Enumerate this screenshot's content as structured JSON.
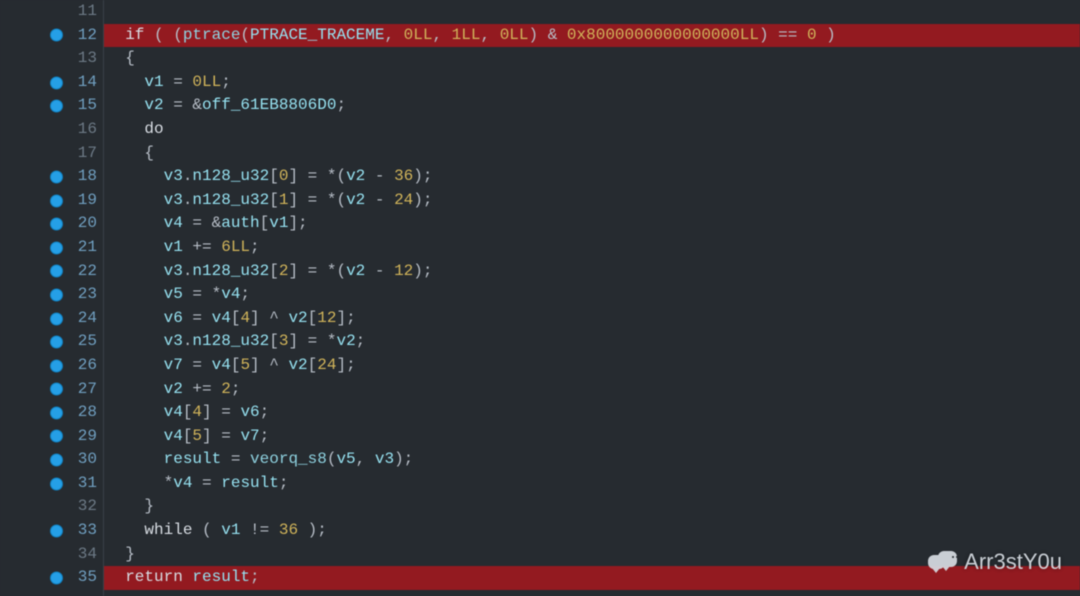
{
  "watermark_text": "Arr3stY0u",
  "lines": [
    {
      "n": 11,
      "bp": false,
      "hl": false,
      "tokens": []
    },
    {
      "n": 12,
      "bp": true,
      "hl": true,
      "tokens": [
        {
          "t": "  ",
          "c": "op"
        },
        {
          "t": "if",
          "c": "kw"
        },
        {
          "t": " ( (",
          "c": "op"
        },
        {
          "t": "ptrace",
          "c": "fn"
        },
        {
          "t": "(",
          "c": "op"
        },
        {
          "t": "PTRACE_TRACEME",
          "c": "id"
        },
        {
          "t": ", ",
          "c": "op"
        },
        {
          "t": "0LL",
          "c": "num"
        },
        {
          "t": ", ",
          "c": "op"
        },
        {
          "t": "1LL",
          "c": "num"
        },
        {
          "t": ", ",
          "c": "op"
        },
        {
          "t": "0LL",
          "c": "num"
        },
        {
          "t": ") & ",
          "c": "op"
        },
        {
          "t": "0x8000000000000000LL",
          "c": "hexnum"
        },
        {
          "t": ") == ",
          "c": "op"
        },
        {
          "t": "0",
          "c": "num"
        },
        {
          "t": " )",
          "c": "op"
        }
      ]
    },
    {
      "n": 13,
      "bp": false,
      "hl": false,
      "tokens": [
        {
          "t": "  {",
          "c": "op"
        }
      ]
    },
    {
      "n": 14,
      "bp": true,
      "hl": false,
      "tokens": [
        {
          "t": "    ",
          "c": "op"
        },
        {
          "t": "v1",
          "c": "id"
        },
        {
          "t": " = ",
          "c": "op"
        },
        {
          "t": "0LL",
          "c": "num"
        },
        {
          "t": ";",
          "c": "op"
        }
      ]
    },
    {
      "n": 15,
      "bp": true,
      "hl": false,
      "tokens": [
        {
          "t": "    ",
          "c": "op"
        },
        {
          "t": "v2",
          "c": "id"
        },
        {
          "t": " = &",
          "c": "op"
        },
        {
          "t": "off_61EB8806D0",
          "c": "id"
        },
        {
          "t": ";",
          "c": "op"
        }
      ]
    },
    {
      "n": 16,
      "bp": false,
      "hl": false,
      "tokens": [
        {
          "t": "    ",
          "c": "op"
        },
        {
          "t": "do",
          "c": "kw"
        }
      ]
    },
    {
      "n": 17,
      "bp": false,
      "hl": false,
      "tokens": [
        {
          "t": "    {",
          "c": "op"
        }
      ]
    },
    {
      "n": 18,
      "bp": true,
      "hl": false,
      "tokens": [
        {
          "t": "      ",
          "c": "op"
        },
        {
          "t": "v3",
          "c": "id"
        },
        {
          "t": ".",
          "c": "op"
        },
        {
          "t": "n128_u32",
          "c": "id"
        },
        {
          "t": "[",
          "c": "op"
        },
        {
          "t": "0",
          "c": "num"
        },
        {
          "t": "] = *(",
          "c": "op"
        },
        {
          "t": "v2",
          "c": "id"
        },
        {
          "t": " - ",
          "c": "op"
        },
        {
          "t": "36",
          "c": "num"
        },
        {
          "t": ");",
          "c": "op"
        }
      ]
    },
    {
      "n": 19,
      "bp": true,
      "hl": false,
      "tokens": [
        {
          "t": "      ",
          "c": "op"
        },
        {
          "t": "v3",
          "c": "id"
        },
        {
          "t": ".",
          "c": "op"
        },
        {
          "t": "n128_u32",
          "c": "id"
        },
        {
          "t": "[",
          "c": "op"
        },
        {
          "t": "1",
          "c": "num"
        },
        {
          "t": "] = *(",
          "c": "op"
        },
        {
          "t": "v2",
          "c": "id"
        },
        {
          "t": " - ",
          "c": "op"
        },
        {
          "t": "24",
          "c": "num"
        },
        {
          "t": ");",
          "c": "op"
        }
      ]
    },
    {
      "n": 20,
      "bp": true,
      "hl": false,
      "tokens": [
        {
          "t": "      ",
          "c": "op"
        },
        {
          "t": "v4",
          "c": "id"
        },
        {
          "t": " = &",
          "c": "op"
        },
        {
          "t": "auth",
          "c": "id"
        },
        {
          "t": "[",
          "c": "op"
        },
        {
          "t": "v1",
          "c": "id"
        },
        {
          "t": "];",
          "c": "op"
        }
      ]
    },
    {
      "n": 21,
      "bp": true,
      "hl": false,
      "tokens": [
        {
          "t": "      ",
          "c": "op"
        },
        {
          "t": "v1",
          "c": "id"
        },
        {
          "t": " += ",
          "c": "op"
        },
        {
          "t": "6LL",
          "c": "num"
        },
        {
          "t": ";",
          "c": "op"
        }
      ]
    },
    {
      "n": 22,
      "bp": true,
      "hl": false,
      "tokens": [
        {
          "t": "      ",
          "c": "op"
        },
        {
          "t": "v3",
          "c": "id"
        },
        {
          "t": ".",
          "c": "op"
        },
        {
          "t": "n128_u32",
          "c": "id"
        },
        {
          "t": "[",
          "c": "op"
        },
        {
          "t": "2",
          "c": "num"
        },
        {
          "t": "] = *(",
          "c": "op"
        },
        {
          "t": "v2",
          "c": "id"
        },
        {
          "t": " - ",
          "c": "op"
        },
        {
          "t": "12",
          "c": "num"
        },
        {
          "t": ");",
          "c": "op"
        }
      ]
    },
    {
      "n": 23,
      "bp": true,
      "hl": false,
      "tokens": [
        {
          "t": "      ",
          "c": "op"
        },
        {
          "t": "v5",
          "c": "id"
        },
        {
          "t": " = *",
          "c": "op"
        },
        {
          "t": "v4",
          "c": "id"
        },
        {
          "t": ";",
          "c": "op"
        }
      ]
    },
    {
      "n": 24,
      "bp": true,
      "hl": false,
      "tokens": [
        {
          "t": "      ",
          "c": "op"
        },
        {
          "t": "v6",
          "c": "id"
        },
        {
          "t": " = ",
          "c": "op"
        },
        {
          "t": "v4",
          "c": "id"
        },
        {
          "t": "[",
          "c": "op"
        },
        {
          "t": "4",
          "c": "num"
        },
        {
          "t": "] ^ ",
          "c": "op"
        },
        {
          "t": "v2",
          "c": "id"
        },
        {
          "t": "[",
          "c": "op"
        },
        {
          "t": "12",
          "c": "num"
        },
        {
          "t": "];",
          "c": "op"
        }
      ]
    },
    {
      "n": 25,
      "bp": true,
      "hl": false,
      "tokens": [
        {
          "t": "      ",
          "c": "op"
        },
        {
          "t": "v3",
          "c": "id"
        },
        {
          "t": ".",
          "c": "op"
        },
        {
          "t": "n128_u32",
          "c": "id"
        },
        {
          "t": "[",
          "c": "op"
        },
        {
          "t": "3",
          "c": "num"
        },
        {
          "t": "] = *",
          "c": "op"
        },
        {
          "t": "v2",
          "c": "id"
        },
        {
          "t": ";",
          "c": "op"
        }
      ]
    },
    {
      "n": 26,
      "bp": true,
      "hl": false,
      "tokens": [
        {
          "t": "      ",
          "c": "op"
        },
        {
          "t": "v7",
          "c": "id"
        },
        {
          "t": " = ",
          "c": "op"
        },
        {
          "t": "v4",
          "c": "id"
        },
        {
          "t": "[",
          "c": "op"
        },
        {
          "t": "5",
          "c": "num"
        },
        {
          "t": "] ^ ",
          "c": "op"
        },
        {
          "t": "v2",
          "c": "id"
        },
        {
          "t": "[",
          "c": "op"
        },
        {
          "t": "24",
          "c": "num"
        },
        {
          "t": "];",
          "c": "op"
        }
      ]
    },
    {
      "n": 27,
      "bp": true,
      "hl": false,
      "tokens": [
        {
          "t": "      ",
          "c": "op"
        },
        {
          "t": "v2",
          "c": "id"
        },
        {
          "t": " += ",
          "c": "op"
        },
        {
          "t": "2",
          "c": "num"
        },
        {
          "t": ";",
          "c": "op"
        }
      ]
    },
    {
      "n": 28,
      "bp": true,
      "hl": false,
      "tokens": [
        {
          "t": "      ",
          "c": "op"
        },
        {
          "t": "v4",
          "c": "id"
        },
        {
          "t": "[",
          "c": "op"
        },
        {
          "t": "4",
          "c": "num"
        },
        {
          "t": "] = ",
          "c": "op"
        },
        {
          "t": "v6",
          "c": "id"
        },
        {
          "t": ";",
          "c": "op"
        }
      ]
    },
    {
      "n": 29,
      "bp": true,
      "hl": false,
      "tokens": [
        {
          "t": "      ",
          "c": "op"
        },
        {
          "t": "v4",
          "c": "id"
        },
        {
          "t": "[",
          "c": "op"
        },
        {
          "t": "5",
          "c": "num"
        },
        {
          "t": "] = ",
          "c": "op"
        },
        {
          "t": "v7",
          "c": "id"
        },
        {
          "t": ";",
          "c": "op"
        }
      ]
    },
    {
      "n": 30,
      "bp": true,
      "hl": false,
      "tokens": [
        {
          "t": "      ",
          "c": "op"
        },
        {
          "t": "result",
          "c": "id"
        },
        {
          "t": " = ",
          "c": "op"
        },
        {
          "t": "veorq_s8",
          "c": "fn"
        },
        {
          "t": "(",
          "c": "op"
        },
        {
          "t": "v5",
          "c": "id"
        },
        {
          "t": ", ",
          "c": "op"
        },
        {
          "t": "v3",
          "c": "id"
        },
        {
          "t": ");",
          "c": "op"
        }
      ]
    },
    {
      "n": 31,
      "bp": true,
      "hl": false,
      "tokens": [
        {
          "t": "      *",
          "c": "op"
        },
        {
          "t": "v4",
          "c": "id"
        },
        {
          "t": " = ",
          "c": "op"
        },
        {
          "t": "result",
          "c": "id"
        },
        {
          "t": ";",
          "c": "op"
        }
      ]
    },
    {
      "n": 32,
      "bp": false,
      "hl": false,
      "tokens": [
        {
          "t": "    }",
          "c": "op"
        }
      ]
    },
    {
      "n": 33,
      "bp": true,
      "hl": false,
      "tokens": [
        {
          "t": "    ",
          "c": "op"
        },
        {
          "t": "while",
          "c": "kw"
        },
        {
          "t": " ( ",
          "c": "op"
        },
        {
          "t": "v1",
          "c": "id"
        },
        {
          "t": " != ",
          "c": "op"
        },
        {
          "t": "36",
          "c": "num"
        },
        {
          "t": " );",
          "c": "op"
        }
      ]
    },
    {
      "n": 34,
      "bp": false,
      "hl": false,
      "tokens": [
        {
          "t": "  }",
          "c": "op"
        }
      ]
    },
    {
      "n": 35,
      "bp": true,
      "hl": true,
      "tokens": [
        {
          "t": "  ",
          "c": "op"
        },
        {
          "t": "return",
          "c": "kw"
        },
        {
          "t": " ",
          "c": "op"
        },
        {
          "t": "result",
          "c": "id"
        },
        {
          "t": ";",
          "c": "op"
        }
      ]
    }
  ]
}
